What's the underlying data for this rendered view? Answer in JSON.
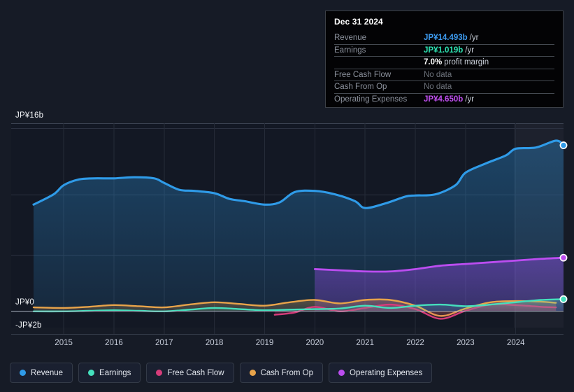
{
  "axis": {
    "y_labels": {
      "top": "JP¥16b",
      "zero": "JP¥0",
      "bottom": "-JP¥2b"
    },
    "x_labels": [
      "2015",
      "2016",
      "2017",
      "2018",
      "2019",
      "2020",
      "2021",
      "2022",
      "2023",
      "2024"
    ]
  },
  "tooltip": {
    "date": "Dec 31 2024",
    "rows": [
      {
        "label": "Revenue",
        "value": "JP¥14.493b",
        "suffix": "/yr",
        "color": "#3d9bf0",
        "nodata": false
      },
      {
        "label": "Earnings",
        "value": "JP¥1.019b",
        "suffix": "/yr",
        "color": "#2ee6b4",
        "nodata": false
      },
      {
        "label": "",
        "value": "7.0%",
        "suffix": "profit margin",
        "color": "#ffffff",
        "nodata": false
      },
      {
        "label": "Free Cash Flow",
        "value": "No data",
        "suffix": "",
        "color": "#6d727b",
        "nodata": true
      },
      {
        "label": "Cash From Op",
        "value": "No data",
        "suffix": "",
        "color": "#6d727b",
        "nodata": true
      },
      {
        "label": "Operating Expenses",
        "value": "JP¥4.650b",
        "suffix": "/yr",
        "color": "#c14ff0",
        "nodata": false
      }
    ]
  },
  "legend": {
    "items": [
      {
        "label": "Revenue",
        "color": "#2f9be8"
      },
      {
        "label": "Earnings",
        "color": "#45e0bd"
      },
      {
        "label": "Free Cash Flow",
        "color": "#d63c7a"
      },
      {
        "label": "Cash From Op",
        "color": "#e8a34a"
      },
      {
        "label": "Operating Expenses",
        "color": "#bb4df0"
      }
    ]
  },
  "chart_data": {
    "type": "area",
    "title": "",
    "xlabel": "",
    "ylabel": "JP¥",
    "ylim": [
      -2,
      16
    ],
    "grid": true,
    "legend_position": "bottom",
    "currency": "JP¥",
    "units": "billions per year",
    "x_range": [
      "2014-06",
      "2024-12"
    ],
    "x_tick_labels": [
      "2015",
      "2016",
      "2017",
      "2018",
      "2019",
      "2020",
      "2021",
      "2022",
      "2023",
      "2024"
    ],
    "highlight_band": {
      "from": "2024-03",
      "to": "2024-12",
      "note": "recent period shading"
    },
    "series": [
      {
        "name": "Revenue",
        "color": "#2f9be8",
        "end_marker": true,
        "x": [
          "2014.4",
          "2014.8",
          "2015.0",
          "2015.3",
          "2015.6",
          "2016.0",
          "2016.4",
          "2016.8",
          "2017.0",
          "2017.3",
          "2017.6",
          "2018.0",
          "2018.3",
          "2018.6",
          "2019.0",
          "2019.3",
          "2019.6",
          "2020.0",
          "2020.4",
          "2020.8",
          "2021.0",
          "2021.4",
          "2021.8",
          "2022.0",
          "2022.4",
          "2022.8",
          "2023.0",
          "2023.4",
          "2023.8",
          "2024.0",
          "2024.4",
          "2024.8",
          "2024.95"
        ],
        "values": [
          9.3,
          10.2,
          11.0,
          11.5,
          11.6,
          11.6,
          11.7,
          11.6,
          11.2,
          10.6,
          10.5,
          10.3,
          9.8,
          9.6,
          9.3,
          9.5,
          10.4,
          10.5,
          10.2,
          9.6,
          9.0,
          9.4,
          10.0,
          10.1,
          10.2,
          11.0,
          12.1,
          12.9,
          13.6,
          14.2,
          14.3,
          14.9,
          14.493
        ]
      },
      {
        "name": "Operating Expenses",
        "color": "#bb4df0",
        "end_marker": true,
        "starts_at": "2020.0",
        "x": [
          "2020.0",
          "2020.5",
          "2021.0",
          "2021.5",
          "2022.0",
          "2022.5",
          "2023.0",
          "2023.5",
          "2024.0",
          "2024.5",
          "2024.95"
        ],
        "values": [
          3.65,
          3.55,
          3.45,
          3.45,
          3.65,
          3.95,
          4.1,
          4.25,
          4.4,
          4.55,
          4.65
        ]
      },
      {
        "name": "Cash From Op",
        "color": "#e8a34a",
        "end_marker": false,
        "x": [
          "2014.4",
          "2015.0",
          "2015.5",
          "2016.0",
          "2016.5",
          "2017.0",
          "2017.5",
          "2018.0",
          "2018.5",
          "2019.0",
          "2019.5",
          "2020.0",
          "2020.5",
          "2021.0",
          "2021.5",
          "2022.0",
          "2022.5",
          "2023.0",
          "2023.5",
          "2024.0",
          "2024.5",
          "2024.8"
        ],
        "values": [
          0.3,
          0.25,
          0.35,
          0.5,
          0.4,
          0.3,
          0.55,
          0.75,
          0.6,
          0.45,
          0.75,
          0.95,
          0.65,
          0.95,
          0.95,
          0.45,
          -0.45,
          0.2,
          0.75,
          0.85,
          0.8,
          0.7
        ]
      },
      {
        "name": "Free Cash Flow",
        "color": "#d63c7a",
        "end_marker": false,
        "starts_at": "2019.2",
        "x": [
          "2019.2",
          "2019.6",
          "2020.0",
          "2020.5",
          "2021.0",
          "2021.5",
          "2022.0",
          "2022.5",
          "2023.0",
          "2023.5",
          "2024.0",
          "2024.5",
          "2024.8"
        ],
        "values": [
          -0.35,
          -0.15,
          0.35,
          -0.05,
          0.25,
          0.55,
          0.15,
          -0.7,
          0.0,
          0.55,
          0.5,
          0.35,
          0.3
        ]
      },
      {
        "name": "Earnings",
        "color": "#45e0bd",
        "end_marker": true,
        "x": [
          "2014.4",
          "2015.0",
          "2015.5",
          "2016.0",
          "2016.5",
          "2017.0",
          "2017.5",
          "2018.0",
          "2018.5",
          "2019.0",
          "2019.5",
          "2020.0",
          "2020.5",
          "2021.0",
          "2021.5",
          "2022.0",
          "2022.5",
          "2023.0",
          "2023.5",
          "2024.0",
          "2024.5",
          "2024.95"
        ],
        "values": [
          -0.05,
          -0.05,
          0.0,
          0.05,
          0.0,
          -0.05,
          0.1,
          0.25,
          0.15,
          0.05,
          0.1,
          0.15,
          0.2,
          0.45,
          0.25,
          0.45,
          0.55,
          0.4,
          0.55,
          0.75,
          0.95,
          1.019
        ]
      }
    ]
  }
}
